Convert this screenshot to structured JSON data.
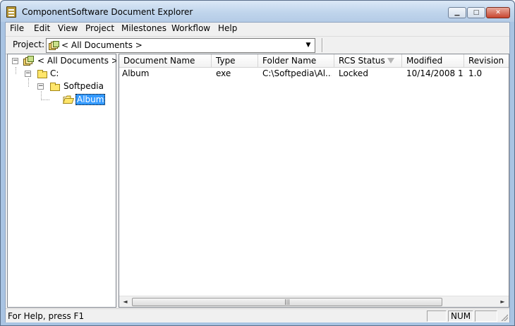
{
  "window": {
    "title": "ComponentSoftware Document Explorer",
    "controls": {
      "minimize": "▁",
      "maximize": "□",
      "close": "✕"
    }
  },
  "menu": [
    "File",
    "Edit",
    "View",
    "Project",
    "Milestones",
    "Workflow",
    "Help"
  ],
  "toolbar": {
    "project_label": "Project:",
    "project_value": "< All Documents >",
    "dropdown_icon": "chevron-down-icon"
  },
  "tree": {
    "root": "< All Documents >",
    "drive": "C:",
    "folder": "Softpedia",
    "selected": "Album",
    "expander_collapse": "−"
  },
  "list": {
    "columns": [
      "Document Name",
      "Type",
      "Folder Name",
      "RCS Status",
      "Modified",
      "Revision"
    ],
    "sorted_column": "RCS Status",
    "rows": [
      [
        "Album",
        "exe",
        "C:\\Softpedia\\Al...",
        "Locked",
        "10/14/2008 1...",
        "1.0"
      ]
    ]
  },
  "scrollbar": {
    "left": "◄",
    "right": "►",
    "thumb_grip": "|||"
  },
  "statusbar": {
    "help_text": "For Help, press F1",
    "panel_1": "",
    "panel_2": "NUM",
    "panel_3": ""
  },
  "colors": {
    "selection": "#3399ff",
    "folder": "#ffe66b",
    "title_bar": "#c0d5ec"
  }
}
